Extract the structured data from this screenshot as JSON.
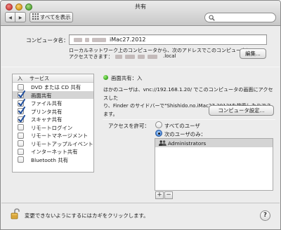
{
  "window": {
    "title": "共有"
  },
  "toolbar": {
    "back_label": "◀",
    "forward_label": "▶",
    "show_all_label": "すべてを表示",
    "search_placeholder": ""
  },
  "computer": {
    "name_label": "コンピュータ名：",
    "name_value": "iMac27.2012",
    "local_note_line1": "ローカルネットワーク上のコンピュータから、次のアドレスでこのコンピュータに",
    "local_note_line2_prefix": "アクセスできます：",
    "local_note_suffix": ".local",
    "edit_button": "編集..."
  },
  "services": {
    "header_on": "入",
    "header_service": "サービス",
    "items": [
      {
        "label": "DVD または CD 共有",
        "checked": false
      },
      {
        "label": "画面共有",
        "checked": true
      },
      {
        "label": "ファイル共有",
        "checked": true
      },
      {
        "label": "プリンタ共有",
        "checked": true
      },
      {
        "label": "スキャナ共有",
        "checked": true
      },
      {
        "label": "リモートログイン",
        "checked": false
      },
      {
        "label": "リモートマネージメント",
        "checked": false
      },
      {
        "label": "リモートアップルイベント",
        "checked": false
      },
      {
        "label": "インターネット共有",
        "checked": false
      },
      {
        "label": "Bluetooth 共有",
        "checked": false
      }
    ],
    "selected_index": 1
  },
  "detail": {
    "status": "画面共有：入",
    "status_color": "#2e9b14",
    "desc_line1": "ほかのユーザは、vnc://192.168.1.20/ でこのコンピュータの画面にアクセスした",
    "desc_line2": "り、Finder のサイドバーで\"Shishido.no.iMac27.2012\"を検索したりできます。",
    "computer_settings_button": "コンピュータ設定...",
    "access_label": "アクセスを許可：",
    "option_all": "すべてのユーザ",
    "option_only": "次のユーザのみ：",
    "selected_option": "only",
    "users": [
      "Administrators"
    ],
    "add_button": "+",
    "remove_button": "−"
  },
  "footer": {
    "lock_text": "変更できないようにするにはカギをクリックします。",
    "help_label": "?"
  }
}
